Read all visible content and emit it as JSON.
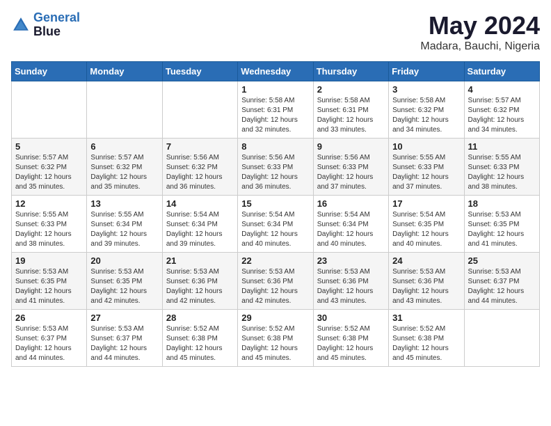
{
  "header": {
    "logo_line1": "General",
    "logo_line2": "Blue",
    "title": "May 2024",
    "subtitle": "Madara, Bauchi, Nigeria"
  },
  "days_of_week": [
    "Sunday",
    "Monday",
    "Tuesday",
    "Wednesday",
    "Thursday",
    "Friday",
    "Saturday"
  ],
  "weeks": [
    [
      {
        "day": "",
        "info": ""
      },
      {
        "day": "",
        "info": ""
      },
      {
        "day": "",
        "info": ""
      },
      {
        "day": "1",
        "info": "Sunrise: 5:58 AM\nSunset: 6:31 PM\nDaylight: 12 hours\nand 32 minutes."
      },
      {
        "day": "2",
        "info": "Sunrise: 5:58 AM\nSunset: 6:31 PM\nDaylight: 12 hours\nand 33 minutes."
      },
      {
        "day": "3",
        "info": "Sunrise: 5:58 AM\nSunset: 6:32 PM\nDaylight: 12 hours\nand 34 minutes."
      },
      {
        "day": "4",
        "info": "Sunrise: 5:57 AM\nSunset: 6:32 PM\nDaylight: 12 hours\nand 34 minutes."
      }
    ],
    [
      {
        "day": "5",
        "info": "Sunrise: 5:57 AM\nSunset: 6:32 PM\nDaylight: 12 hours\nand 35 minutes."
      },
      {
        "day": "6",
        "info": "Sunrise: 5:57 AM\nSunset: 6:32 PM\nDaylight: 12 hours\nand 35 minutes."
      },
      {
        "day": "7",
        "info": "Sunrise: 5:56 AM\nSunset: 6:32 PM\nDaylight: 12 hours\nand 36 minutes."
      },
      {
        "day": "8",
        "info": "Sunrise: 5:56 AM\nSunset: 6:33 PM\nDaylight: 12 hours\nand 36 minutes."
      },
      {
        "day": "9",
        "info": "Sunrise: 5:56 AM\nSunset: 6:33 PM\nDaylight: 12 hours\nand 37 minutes."
      },
      {
        "day": "10",
        "info": "Sunrise: 5:55 AM\nSunset: 6:33 PM\nDaylight: 12 hours\nand 37 minutes."
      },
      {
        "day": "11",
        "info": "Sunrise: 5:55 AM\nSunset: 6:33 PM\nDaylight: 12 hours\nand 38 minutes."
      }
    ],
    [
      {
        "day": "12",
        "info": "Sunrise: 5:55 AM\nSunset: 6:33 PM\nDaylight: 12 hours\nand 38 minutes."
      },
      {
        "day": "13",
        "info": "Sunrise: 5:55 AM\nSunset: 6:34 PM\nDaylight: 12 hours\nand 39 minutes."
      },
      {
        "day": "14",
        "info": "Sunrise: 5:54 AM\nSunset: 6:34 PM\nDaylight: 12 hours\nand 39 minutes."
      },
      {
        "day": "15",
        "info": "Sunrise: 5:54 AM\nSunset: 6:34 PM\nDaylight: 12 hours\nand 40 minutes."
      },
      {
        "day": "16",
        "info": "Sunrise: 5:54 AM\nSunset: 6:34 PM\nDaylight: 12 hours\nand 40 minutes."
      },
      {
        "day": "17",
        "info": "Sunrise: 5:54 AM\nSunset: 6:35 PM\nDaylight: 12 hours\nand 40 minutes."
      },
      {
        "day": "18",
        "info": "Sunrise: 5:53 AM\nSunset: 6:35 PM\nDaylight: 12 hours\nand 41 minutes."
      }
    ],
    [
      {
        "day": "19",
        "info": "Sunrise: 5:53 AM\nSunset: 6:35 PM\nDaylight: 12 hours\nand 41 minutes."
      },
      {
        "day": "20",
        "info": "Sunrise: 5:53 AM\nSunset: 6:35 PM\nDaylight: 12 hours\nand 42 minutes."
      },
      {
        "day": "21",
        "info": "Sunrise: 5:53 AM\nSunset: 6:36 PM\nDaylight: 12 hours\nand 42 minutes."
      },
      {
        "day": "22",
        "info": "Sunrise: 5:53 AM\nSunset: 6:36 PM\nDaylight: 12 hours\nand 42 minutes."
      },
      {
        "day": "23",
        "info": "Sunrise: 5:53 AM\nSunset: 6:36 PM\nDaylight: 12 hours\nand 43 minutes."
      },
      {
        "day": "24",
        "info": "Sunrise: 5:53 AM\nSunset: 6:36 PM\nDaylight: 12 hours\nand 43 minutes."
      },
      {
        "day": "25",
        "info": "Sunrise: 5:53 AM\nSunset: 6:37 PM\nDaylight: 12 hours\nand 44 minutes."
      }
    ],
    [
      {
        "day": "26",
        "info": "Sunrise: 5:53 AM\nSunset: 6:37 PM\nDaylight: 12 hours\nand 44 minutes."
      },
      {
        "day": "27",
        "info": "Sunrise: 5:53 AM\nSunset: 6:37 PM\nDaylight: 12 hours\nand 44 minutes."
      },
      {
        "day": "28",
        "info": "Sunrise: 5:52 AM\nSunset: 6:38 PM\nDaylight: 12 hours\nand 45 minutes."
      },
      {
        "day": "29",
        "info": "Sunrise: 5:52 AM\nSunset: 6:38 PM\nDaylight: 12 hours\nand 45 minutes."
      },
      {
        "day": "30",
        "info": "Sunrise: 5:52 AM\nSunset: 6:38 PM\nDaylight: 12 hours\nand 45 minutes."
      },
      {
        "day": "31",
        "info": "Sunrise: 5:52 AM\nSunset: 6:38 PM\nDaylight: 12 hours\nand 45 minutes."
      },
      {
        "day": "",
        "info": ""
      }
    ]
  ]
}
